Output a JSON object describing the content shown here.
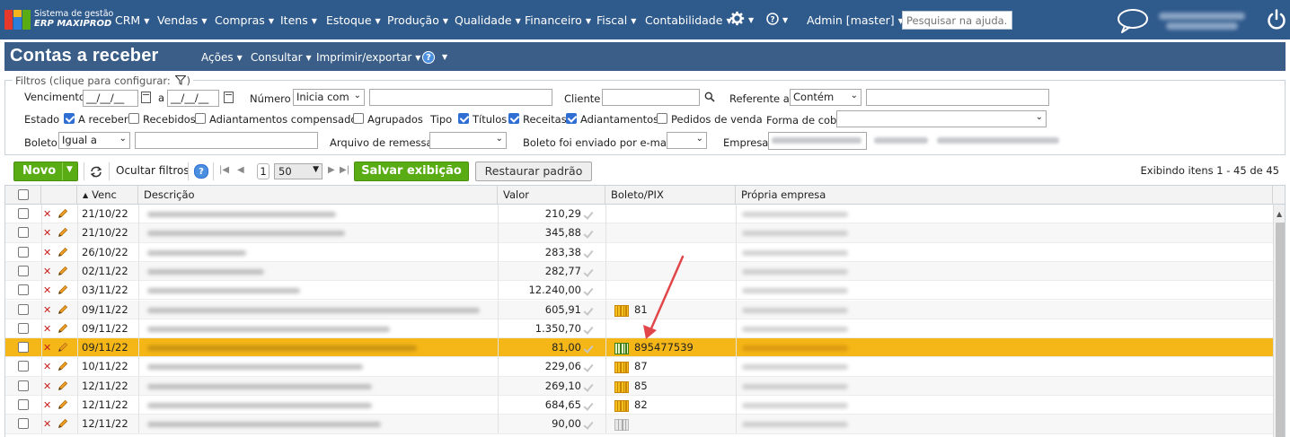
{
  "app": {
    "logo_line1": "Sistema de gestão",
    "logo_line2": "ERP MAXIPROD"
  },
  "nav": {
    "items": [
      "CRM",
      "Vendas",
      "Compras",
      "Itens",
      "Estoque",
      "Produção",
      "Qualidade",
      "Financeiro",
      "Fiscal",
      "Contabilidade"
    ],
    "user": "Admin [master]",
    "help_placeholder": "Pesquisar na ajuda..."
  },
  "page": {
    "title": "Contas a receber",
    "menus": [
      "Ações",
      "Consultar",
      "Imprimir/exportar"
    ]
  },
  "filters": {
    "legend": "Filtros (clique para configurar:",
    "legend_close": ")",
    "vencimento_label": "Vencimento",
    "date_from": "__/__/__",
    "date_sep": "a",
    "date_to": "__/__/__",
    "numero_label": "Número",
    "numero_op": "Inicia com",
    "cliente_label": "Cliente",
    "referente_label": "Referente a",
    "referente_op": "Contém",
    "estado_label": "Estado",
    "estado_options": [
      {
        "label": "A receber",
        "checked": true
      },
      {
        "label": "Recebidos",
        "checked": false
      },
      {
        "label": "Adiantamentos compensados",
        "checked": false
      },
      {
        "label": "Agrupados",
        "checked": false
      }
    ],
    "tipo_label": "Tipo",
    "tipo_options": [
      {
        "label": "Títulos",
        "checked": true
      },
      {
        "label": "Receitas",
        "checked": true
      },
      {
        "label": "Adiantamentos",
        "checked": true
      },
      {
        "label": "Pedidos de venda",
        "checked": false
      }
    ],
    "forma_label": "Forma de cobrança",
    "boleto_label": "Boleto",
    "boleto_op": "Igual a",
    "arquivo_label": "Arquivo de remessa",
    "enviado_label": "Boleto foi enviado por e-mail",
    "empresa_label": "Empresa"
  },
  "toolbar": {
    "novo": "Novo",
    "ocultar": "Ocultar filtros",
    "page": "1",
    "page_size": "50",
    "salvar": "Salvar exibição",
    "restaurar": "Restaurar padrão",
    "count": "Exibindo itens 1 - 45 de 45"
  },
  "grid": {
    "columns": {
      "venc": "Venc",
      "descricao": "Descrição",
      "valor": "Valor",
      "boleto": "Boleto/PIX",
      "empresa": "Própria empresa"
    },
    "rows": [
      {
        "venc": "21/10/22",
        "valor": "210,29",
        "boleto": ""
      },
      {
        "venc": "21/10/22",
        "valor": "345,88",
        "boleto": ""
      },
      {
        "venc": "26/10/22",
        "valor": "283,38",
        "boleto": ""
      },
      {
        "venc": "02/11/22",
        "valor": "282,77",
        "boleto": ""
      },
      {
        "venc": "03/11/22",
        "valor": "12.240,00",
        "boleto": ""
      },
      {
        "venc": "09/11/22",
        "valor": "605,91",
        "boleto": "81"
      },
      {
        "venc": "09/11/22",
        "valor": "1.350,70",
        "boleto": ""
      },
      {
        "venc": "09/11/22",
        "valor": "81,00",
        "boleto": "895477539",
        "selected": true
      },
      {
        "venc": "10/11/22",
        "valor": "229,06",
        "boleto": "87"
      },
      {
        "venc": "12/11/22",
        "valor": "269,10",
        "boleto": "85"
      },
      {
        "venc": "12/11/22",
        "valor": "684,65",
        "boleto": "82"
      },
      {
        "venc": "12/11/22",
        "valor": "90,00",
        "boleto": ""
      }
    ]
  },
  "colors": {
    "nav_bg": "#2f5a8c",
    "header_bg": "#3a5e88",
    "accent_green": "#5aac14",
    "selected_row": "#f5b617",
    "arrow": "#e0464a"
  },
  "icons": [
    "settings-gear-icon",
    "help-icon",
    "chat-icon",
    "power-icon",
    "filter-funnel-icon",
    "calendar-icon",
    "search-icon",
    "refresh-icon",
    "delete-x-icon",
    "edit-pencil-icon",
    "barcode-icon",
    "check-icon"
  ]
}
